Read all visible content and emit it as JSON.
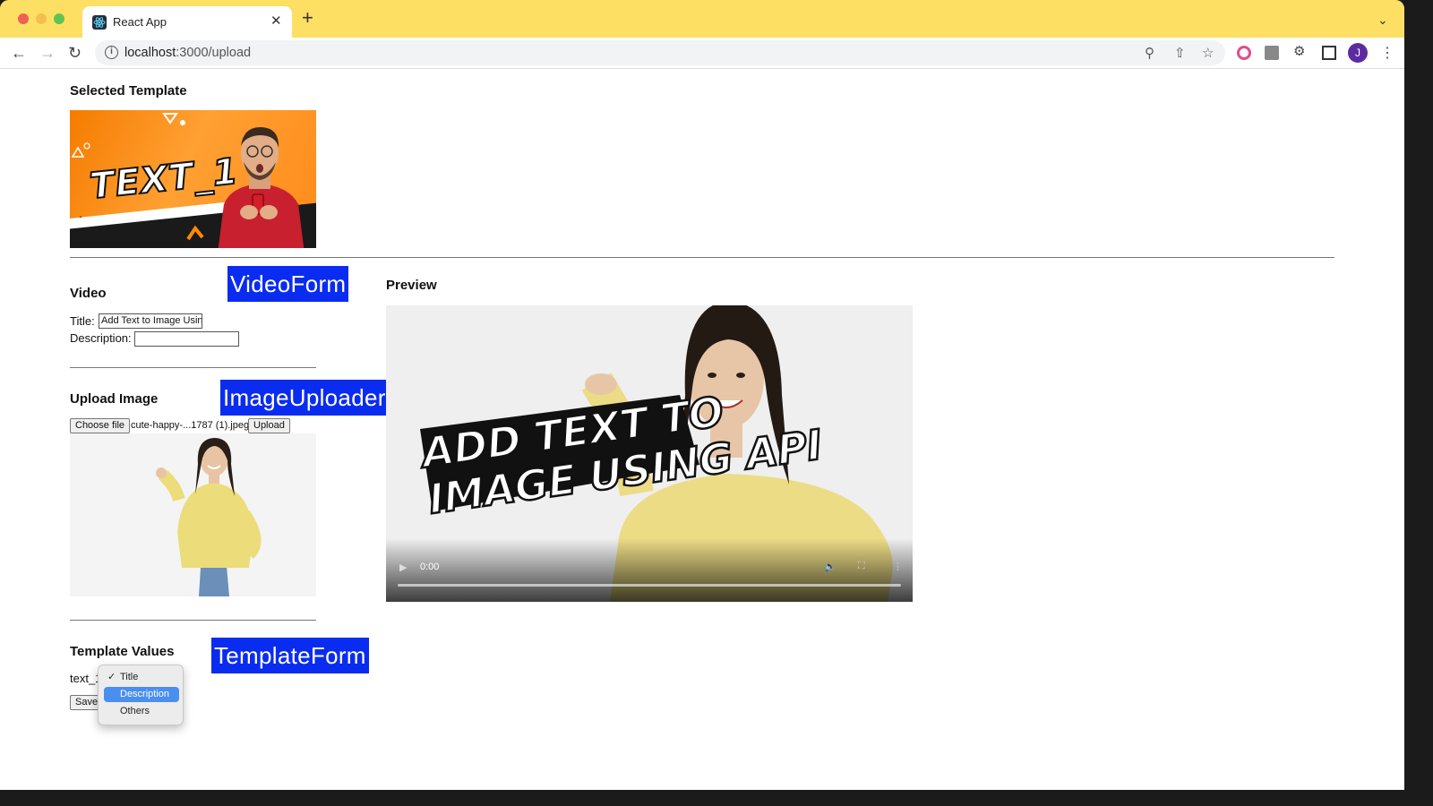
{
  "browser": {
    "tab_title": "React App",
    "tab_close": "✕",
    "new_tab": "+",
    "url_host": "localhost",
    "url_path": ":3000/upload",
    "avatar_initial": "J"
  },
  "selected_template": {
    "heading": "Selected Template",
    "thumbnail_text": "TEXT_1"
  },
  "video_form": {
    "heading": "Video",
    "annotation": "VideoForm",
    "title_label": "Title:",
    "title_value": "Add Text to Image Using API",
    "description_label": "Description:",
    "description_value": ""
  },
  "image_uploader": {
    "heading": "Upload Image",
    "annotation": "ImageUploader",
    "choose_file_label": "Choose file",
    "file_name": "cute-happy-...1787 (1).jpeg",
    "upload_label": "Upload"
  },
  "preview": {
    "heading": "Preview",
    "overlay_text_line1": "ADD TEXT TO",
    "overlay_text_line2": "IMAGE USING API",
    "time": "0:00"
  },
  "template_form": {
    "heading": "Template Values",
    "annotation": "TemplateForm",
    "field_label": "text_1",
    "save_label": "Save",
    "dropdown_options": [
      {
        "label": "Title",
        "checked": true
      },
      {
        "label": "Description",
        "highlighted": true
      },
      {
        "label": "Others"
      }
    ]
  },
  "colors": {
    "chrome_titlebar": "#fde063",
    "annotation_blue": "#0a2cf0",
    "dropdown_highlight": "#4a8ef0"
  }
}
